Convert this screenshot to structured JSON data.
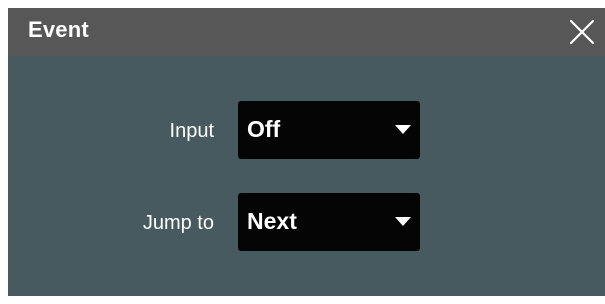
{
  "dialog": {
    "title": "Event",
    "close_icon": "close-icon",
    "colors": {
      "titlebar": "#575757",
      "body": "#465a60",
      "select_bg": "#050505",
      "text": "#ffffff"
    }
  },
  "fields": {
    "input": {
      "label": "Input",
      "value": "Off",
      "icon": "caret-down-icon"
    },
    "jump_to": {
      "label": "Jump to",
      "value": "Next",
      "icon": "caret-down-icon"
    }
  }
}
